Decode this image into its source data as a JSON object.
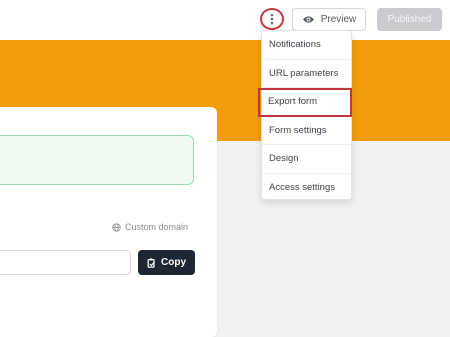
{
  "header": {
    "preview_label": "Preview",
    "published_label": "Published",
    "more_icon": "kebab-vertical-icon",
    "preview_icon": "eye-icon"
  },
  "menu": {
    "items": [
      {
        "label": "Notifications"
      },
      {
        "label": "URL parameters"
      },
      {
        "label": "Export form",
        "highlighted": true
      },
      {
        "label": "Form settings"
      },
      {
        "label": "Design"
      },
      {
        "label": "Access settings"
      }
    ]
  },
  "share": {
    "custom_domain_label": "Custom domain",
    "custom_domain_icon": "globe-icon",
    "copy_label": "Copy",
    "copy_icon": "clipboard-icon",
    "link_value": ""
  },
  "colors": {
    "banner": "#f39c0c",
    "highlight": "#c4343a",
    "copy_button": "#1f2633"
  }
}
